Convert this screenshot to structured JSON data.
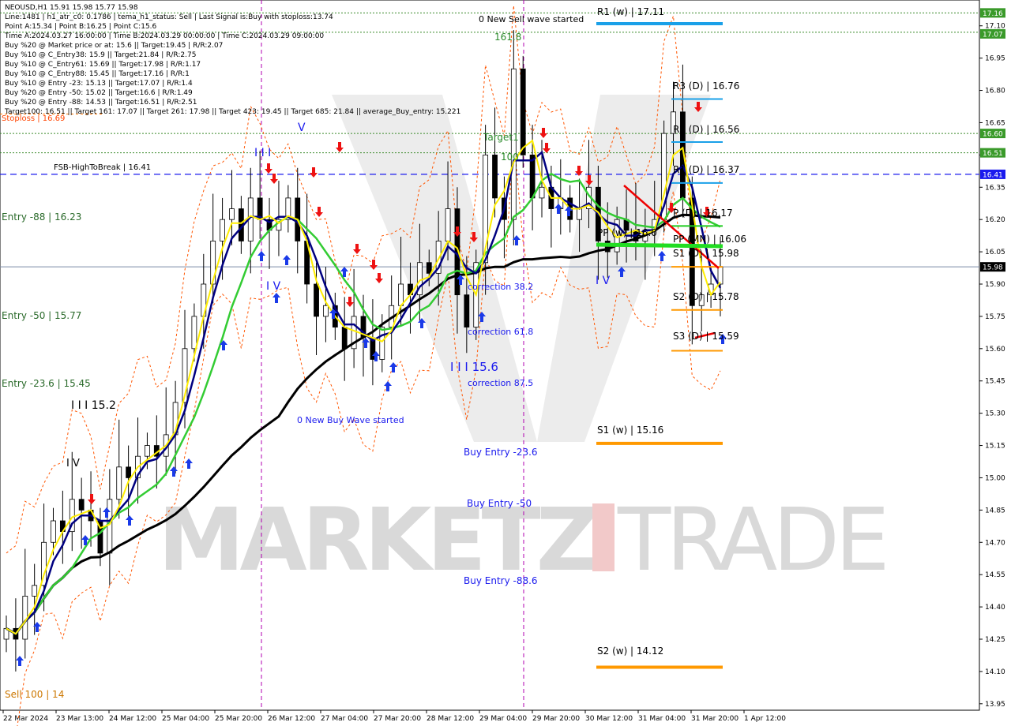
{
  "header": {
    "lines": [
      "NEOUSD,H1  15.91 15.98 15.77 15.98",
      "Line:1481 | h1_atr_c0: 0.1786 | tema_h1_status: Sell | Last Signal is:Buy with stoploss:13.74",
      "Point A:15.34 | Point B:16.25 | Point C:15.6",
      "Time A:2024.03.27 16:00:00 | Time B:2024.03.29 00:00:00 | Time C:2024.03.29 09:00:00",
      "Buy %20 @ Market price or at: 15.6 || Target:19.45 | R/R:2.07",
      "Buy %10 @ C_Entry38: 15.9 || Target:21.84 | R/R:2.75",
      "Buy %10 @ C_Entry61: 15.69 || Target:17.98 | R/R:1.17",
      "Buy %10 @ C_Entry88: 15.45 || Target:17.16 | R/R:1",
      "Buy %10 @ Entry -23: 15.13 || Target:17.07 | R/R:1.4",
      "Buy %20 @ Entry -50: 15.02 || Target:16.6 | R/R:1.49",
      "Buy %20 @ Entry -88: 14.53 || Target:16.51 | R/R:2.51",
      "Target100: 16.51 || Target 161: 17.07 || Target 261: 17.98 || Target 423: 19.45 || Target 685: 21.84 || average_Buy_entry: 15.221"
    ]
  },
  "annotations": {
    "stoploss": "Stoploss | 16.69",
    "fsb": "FSB-HighToBreak | 16.41",
    "entry88": "Entry -88 | 16.23",
    "entry50": "Entry -50 | 15.77",
    "entry236": "Entry -23.6 | 15.45",
    "iii152": "I I I 15.2",
    "iv": "I V",
    "sell100": "Sell 100 | 14",
    "new_sell": "0 New Sell wave started",
    "new_buy": "0 New Buy Wave started",
    "correction382": "correction 38.2",
    "correction618": "correction 61.8",
    "correction875": "correction 87.5",
    "iii156": "I I I 15.6",
    "buy_entry_236": "Buy Entry -23.6",
    "buy_entry_50": "Buy Entry -50",
    "buy_entry_886": "Buy Entry -88.6",
    "target1": "Target1",
    "t100": "100",
    "t1618": "161.8",
    "roman_iii": "I I I",
    "roman_v": "V",
    "roman_iv": "I V",
    "roman_iv2": "I V"
  },
  "pivots": {
    "r1w": "R1 (w) | 17.11",
    "r3d": "R3 (D) | 16.76",
    "r2d": "R2 (D) | 16.56",
    "r1d": "R1 (D) | 16.37",
    "pd": "P (D) | 16.17",
    "pp": "PP (MN) | 16.06",
    "s1d": "S1 (D) | 15.98",
    "s2d": "S2 (D) | 15.78",
    "s3d": "S3 (D) | 15.59",
    "s1w": "S1 (w) | 15.16",
    "s2w": "S2 (w) | 14.12",
    "ppw": "PP (w) | 16.0"
  },
  "watermark": {
    "left": "MARKETZ",
    "right": "TRADE"
  },
  "price_badges": [
    {
      "label": "17.16",
      "color": "#3a9a2a"
    },
    {
      "label": "17.07",
      "color": "#3a9a2a"
    },
    {
      "label": "16.60",
      "color": "#3a9a2a"
    },
    {
      "label": "16.51",
      "color": "#3a9a2a"
    },
    {
      "label": "16.41",
      "color": "#1a1aee"
    },
    {
      "label": "15.98",
      "color": "#000000"
    }
  ],
  "chart_data": {
    "type": "candlestick",
    "symbol": "NEOUSD",
    "timeframe": "H1",
    "ohlc_last": [
      15.91,
      15.98,
      15.77,
      15.98
    ],
    "y_ticks": [
      17.1,
      16.95,
      16.8,
      16.65,
      16.5,
      16.35,
      16.2,
      16.05,
      15.9,
      15.75,
      15.6,
      15.45,
      15.3,
      15.15,
      15.0,
      14.85,
      14.7,
      14.55,
      14.4,
      14.25,
      14.1,
      13.95
    ],
    "x_ticks": [
      "22 Mar 2024",
      "23 Mar 13:00",
      "24 Mar 12:00",
      "25 Mar 04:00",
      "25 Mar 20:00",
      "26 Mar 12:00",
      "27 Mar 04:00",
      "27 Mar 20:00",
      "28 Mar 12:00",
      "29 Mar 04:00",
      "29 Mar 20:00",
      "30 Mar 12:00",
      "31 Mar 04:00",
      "31 Mar 20:00",
      "1 Apr 12:00"
    ],
    "ylim": [
      13.92,
      17.22
    ],
    "levels": {
      "stoploss": 16.69,
      "fsb_high_to_break": 16.41,
      "target100": 16.51,
      "target161": 17.07,
      "current": 15.98
    },
    "series": [
      {
        "name": "close",
        "values": [
          14.3,
          14.25,
          14.45,
          14.5,
          14.7,
          14.8,
          14.75,
          14.9,
          14.85,
          14.8,
          14.65,
          14.9,
          15.05,
          15.0,
          15.1,
          15.15,
          15.1,
          15.2,
          15.35,
          15.6,
          15.75,
          15.9,
          16.1,
          16.2,
          16.25,
          16.1,
          16.3,
          16.2,
          16.15,
          16.2,
          16.3,
          16.1,
          15.9,
          15.75,
          15.8,
          15.7,
          15.6,
          15.75,
          15.65,
          15.55,
          15.7,
          15.8,
          15.9,
          15.85,
          16.0,
          15.95,
          16.1,
          16.25,
          15.85,
          15.7,
          16.0,
          16.5,
          16.3,
          16.2,
          16.9,
          16.5,
          16.3,
          16.35,
          16.25,
          16.3,
          16.2,
          16.25,
          16.35,
          16.1,
          16.05,
          16.2,
          16.15,
          16.1,
          16.15,
          16.2,
          16.6,
          16.7,
          16.3,
          15.8,
          15.85,
          15.9,
          15.98
        ]
      }
    ]
  }
}
